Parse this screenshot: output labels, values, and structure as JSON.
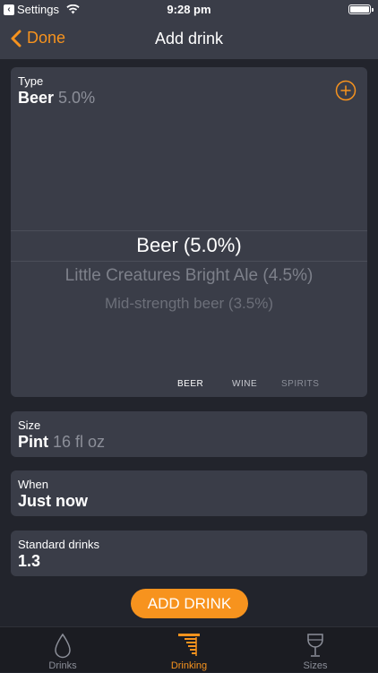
{
  "status_bar": {
    "back_app": "Settings",
    "time": "9:28 pm"
  },
  "nav": {
    "back_label": "Done",
    "title": "Add drink"
  },
  "type_card": {
    "label": "Type",
    "value": "Beer",
    "value_sub": "5.0%",
    "picker": {
      "selected": "Beer (5.0%)",
      "options": [
        "Little Creatures Bright Ale (4.5%)",
        "Mid-strength beer (3.5%)"
      ]
    },
    "segments": [
      {
        "label": "BEER",
        "active": true
      },
      {
        "label": "WINE",
        "active": false
      },
      {
        "label": "SPIRITS",
        "active": false
      }
    ]
  },
  "size_card": {
    "label": "Size",
    "value": "Pint",
    "value_sub": "16 fl oz"
  },
  "when_card": {
    "label": "When",
    "value": "Just now"
  },
  "std_card": {
    "label": "Standard drinks",
    "value": "1.3"
  },
  "add_button": "ADD DRINK",
  "tabs": [
    {
      "label": "Drinks",
      "icon": "drop-icon",
      "active": false
    },
    {
      "label": "Drinking",
      "icon": "drinking-icon",
      "active": true
    },
    {
      "label": "Sizes",
      "icon": "glass-icon",
      "active": false
    }
  ],
  "colors": {
    "accent": "#f7931e",
    "background": "#22242c",
    "card": "#3a3d48",
    "muted": "#8c8f99"
  }
}
